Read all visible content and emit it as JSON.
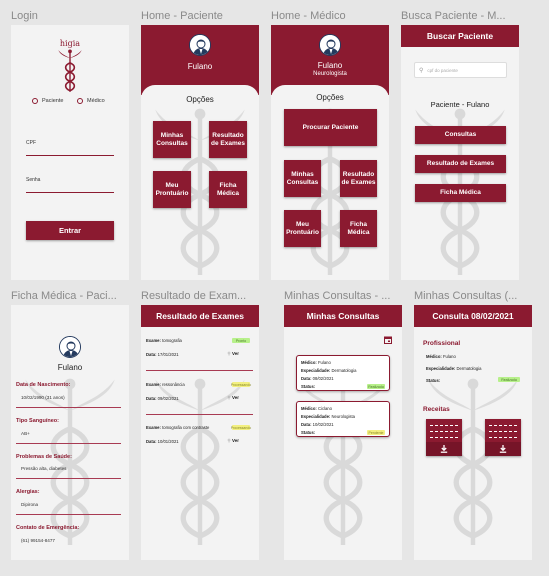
{
  "frames": {
    "login": "Login",
    "home_paciente": "Home - Paciente",
    "home_medico": "Home - Médico",
    "busca": "Busca Paciente - M...",
    "ficha": "Ficha Médica - Paci...",
    "resultado": "Resultado de Exam...",
    "minhas": "Minhas Consultas - ...",
    "consulta": "Minhas Consultas (..."
  },
  "colors": {
    "brand": "#8b1a30",
    "frame_bg": "#f3f3f3",
    "status_green": "#b7f08a",
    "status_yellow": "#f2ef80"
  },
  "login": {
    "logo_text": "higia",
    "radio_paciente": "Paciente",
    "radio_medico": "Médico",
    "cpf_label": "CPF",
    "senha_label": "Senha",
    "enter_button": "Entrar"
  },
  "home_paciente": {
    "name": "Fulano",
    "options": "Opções",
    "btn_consultas": "Minhas Consultas",
    "btn_resultado": "Resultado de Exames",
    "btn_prontuario": "Meu Prontuário",
    "btn_ficha": "Ficha Médica"
  },
  "home_medico": {
    "name": "Fulano",
    "role": "Neurologista",
    "options": "Opções",
    "btn_procurar": "Procurar Paciente",
    "btn_consultas": "Minhas Consultas",
    "btn_resultado": "Resultado de Exames",
    "btn_prontuario": "Meu Prontuário",
    "btn_ficha": "Ficha Médica"
  },
  "busca": {
    "title": "Buscar Paciente",
    "search_placeholder": "cpf do paciente",
    "patient": "Paciente - Fulano",
    "btn_consultas": "Consultas",
    "btn_resultado": "Resultado de Exames",
    "btn_ficha": "Ficha Médica"
  },
  "ficha": {
    "name": "Fulano",
    "fields": [
      {
        "label": "Data de Nascimento:",
        "value": "10/02/1990 (31 anos)"
      },
      {
        "label": "Tipo Sanguíneo:",
        "value": "AB+"
      },
      {
        "label": "Problemas de Saúde:",
        "value": "Pressão alta, diabetes"
      },
      {
        "label": "Alergias:",
        "value": "Dipirona"
      },
      {
        "label": "Contato de Emergência:",
        "value": "(61) 99154-8477"
      }
    ]
  },
  "resultado": {
    "title": "Resultado de Exames",
    "exame_key": "Exame:",
    "data_key": "Data:",
    "ver": "Ver",
    "items": [
      {
        "exame": "tomografia",
        "data": "17/01/2021",
        "status": "Pronto",
        "color": "#b7f08a"
      },
      {
        "exame": "ressonância",
        "data": "09/02/2021",
        "status": "Processando",
        "color": "#f2ef80"
      },
      {
        "exame": "tomografia com contraste",
        "data": "10/01/2021",
        "status": "Processando",
        "color": "#f2ef80"
      }
    ]
  },
  "minhas": {
    "title": "Minhas Consultas",
    "k_medico": "Médico:",
    "k_esp": "Especialidade:",
    "k_data": "Data:",
    "k_status": "Status:",
    "cards": [
      {
        "medico": "Fulano",
        "esp": "Dermatologia",
        "data": "08/02/2021",
        "status": "Realizada",
        "color": "#b7f08a"
      },
      {
        "medico": "Ciclano",
        "esp": "Neurologista",
        "data": "10/02/2021",
        "status": "Pendente",
        "color": "#f2ef80"
      }
    ]
  },
  "consulta": {
    "title": "Consulta 08/02/2021",
    "profissional": "Profissional",
    "k_medico": "Médico:",
    "v_medico": "Fulano",
    "k_esp": "Especialidade:",
    "v_esp": "Dermatologia",
    "k_status": "Status:",
    "v_status": "Realizada",
    "receitas": "Receitas"
  }
}
